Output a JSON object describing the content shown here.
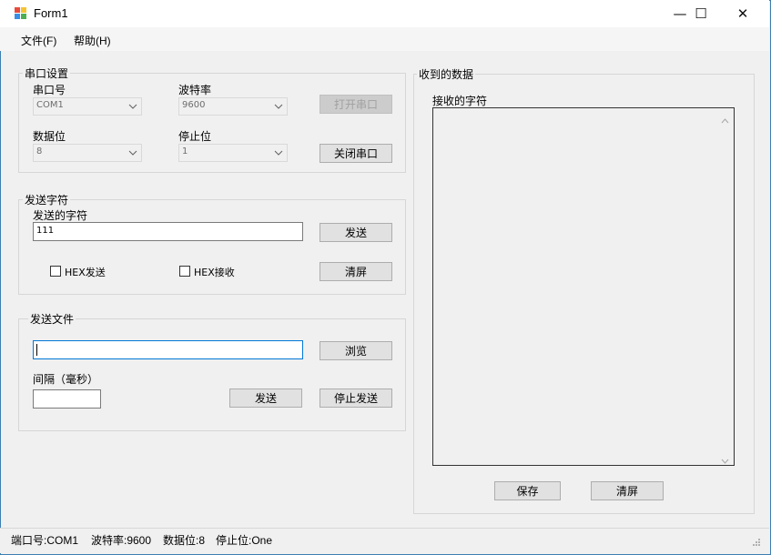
{
  "window": {
    "title": "Form1",
    "minimize": "—",
    "maximize": "☐",
    "close": "✕"
  },
  "menu": [
    {
      "label": "文件(F)"
    },
    {
      "label": "帮助(H)"
    }
  ],
  "serial_settings": {
    "title": "串口设置",
    "port_label": "串口号",
    "port_value": "COM1",
    "baud_label": "波特率",
    "baud_value": "9600",
    "databits_label": "数据位",
    "databits_value": "8",
    "stopbits_label": "停止位",
    "stopbits_value": "1",
    "open_button": "打开串口",
    "close_button": "关闭串口"
  },
  "send_chars": {
    "title": "发送字符",
    "label": "发送的字符",
    "value": "111",
    "send_button": "发送",
    "hex_send_label": "HEX发送",
    "hex_receive_label": "HEX接收",
    "clear_button": "清屏"
  },
  "send_file": {
    "title": "发送文件",
    "path_value": "",
    "browse_button": "浏览",
    "interval_label": "间隔（毫秒）",
    "interval_value": "",
    "send_button": "发送",
    "stop_button": "停止发送"
  },
  "received": {
    "title": "收到的数据",
    "label": "接收的字符",
    "content": "",
    "save_button": "保存",
    "clear_button": "清屏"
  },
  "status": {
    "port": "端口号:COM1",
    "baud": "波特率:9600",
    "databits": "数据位:8",
    "stopbits": "停止位:One"
  },
  "icons": {
    "app": "form-app-icon",
    "dropdown": "chevron-down-icon",
    "scroll_up": "chevron-up-icon",
    "scroll_down": "chevron-down-icon",
    "grip": "resize-grip-icon"
  },
  "colors": {
    "window_border": "#3c7fb1",
    "focus_border": "#0078d7",
    "form_background": "#f0f0f0"
  }
}
